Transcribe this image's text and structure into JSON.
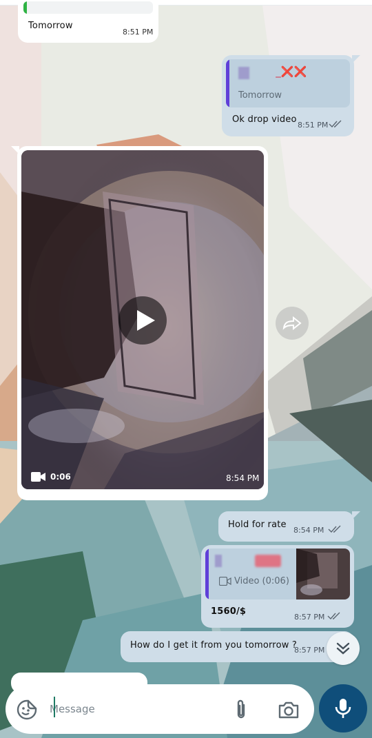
{
  "messages": {
    "m1": {
      "text": "Tomorrow",
      "time": "8:51 PM"
    },
    "m2": {
      "reply_name_tail": "_❌❌",
      "reply_text": "Tomorrow",
      "text": "Ok drop video",
      "time": "8:51 PM"
    },
    "m3": {
      "duration": "0:06",
      "time": "8:54 PM"
    },
    "m4": {
      "text": "Hold for rate",
      "time": "8:54 PM"
    },
    "m5": {
      "reply_text": "Video (0:06)",
      "text": "1560/$",
      "time": "8:57 PM"
    },
    "m6": {
      "text": "How do I get it from you tomorrow ?",
      "time": "8:57 PM"
    }
  },
  "composer": {
    "placeholder": "Message"
  },
  "icons": {
    "sticker": "sticker-icon",
    "attach": "paperclip-icon",
    "camera": "camera-icon",
    "mic": "microphone-icon",
    "share": "forward-icon",
    "scroll": "double-chevron-down-icon",
    "play": "play-icon",
    "video": "video-camera-icon",
    "ticks": "double-check-icon"
  },
  "colors": {
    "outgoing_bubble": "#cfdde8",
    "incoming_bubble": "#ffffff",
    "reply_accent": "#5f3fd8",
    "mic_button": "#0f4e7a"
  }
}
